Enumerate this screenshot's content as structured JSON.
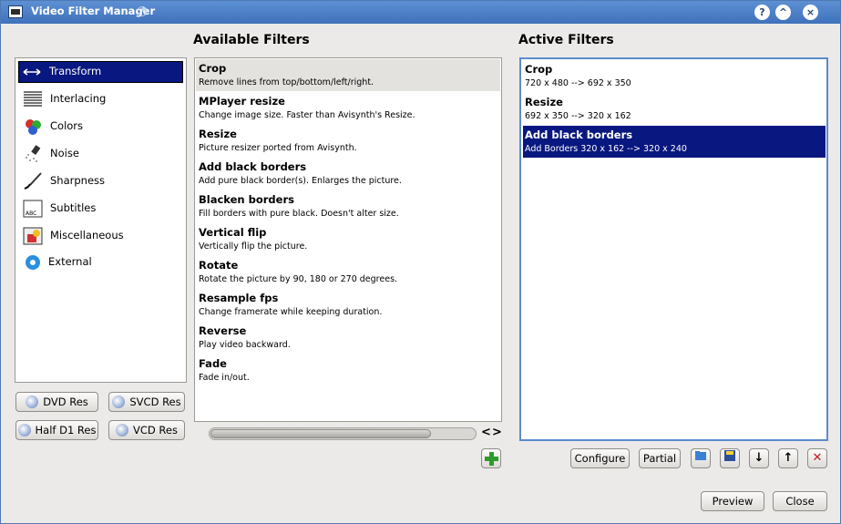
{
  "window": {
    "title": "Video Filter Manager",
    "help": "?",
    "shade": "^",
    "close": "×"
  },
  "sections": {
    "available": "Available Filters",
    "active": "Active Filters"
  },
  "categories": [
    {
      "label": "Transform",
      "icon": "transform-icon",
      "selected": true
    },
    {
      "label": "Interlacing",
      "icon": "interlacing-icon"
    },
    {
      "label": "Colors",
      "icon": "colors-icon"
    },
    {
      "label": "Noise",
      "icon": "noise-icon"
    },
    {
      "label": "Sharpness",
      "icon": "sharpness-icon"
    },
    {
      "label": "Subtitles",
      "icon": "subtitles-icon"
    },
    {
      "label": "Miscellaneous",
      "icon": "miscellaneous-icon"
    },
    {
      "label": "External",
      "icon": "external-icon"
    }
  ],
  "presets": {
    "dvd": "DVD Res",
    "svcd": "SVCD Res",
    "half_d1": "Half D1 Res",
    "vcd": "VCD Res"
  },
  "filters": [
    {
      "name": "Crop",
      "desc": "Remove lines from top/bottom/left/right."
    },
    {
      "name": "MPlayer resize",
      "desc": "Change image size. Faster than Avisynth's Resize."
    },
    {
      "name": "Resize",
      "desc": "Picture resizer ported from Avisynth."
    },
    {
      "name": "Add black borders",
      "desc": "Add pure black border(s). Enlarges the picture."
    },
    {
      "name": "Blacken borders",
      "desc": "Fill borders with pure black. Doesn't alter size."
    },
    {
      "name": "Vertical flip",
      "desc": "Vertically flip the picture."
    },
    {
      "name": "Rotate",
      "desc": "Rotate the picture by 90, 180 or 270 degrees."
    },
    {
      "name": "Resample fps",
      "desc": "Change framerate while keeping duration."
    },
    {
      "name": "Reverse",
      "desc": "Play video backward."
    },
    {
      "name": "Fade",
      "desc": "Fade in/out."
    }
  ],
  "scroll": {
    "left": "<",
    "right": ">"
  },
  "active_filters": [
    {
      "name": "Crop",
      "desc": "720 x 480 --> 692 x 350"
    },
    {
      "name": "Resize",
      "desc": "692 x 350 --> 320 x 162"
    },
    {
      "name": "Add black borders",
      "desc": "Add Borders 320 x 162 --> 320 x 240"
    }
  ],
  "actions": {
    "configure": "Configure",
    "partial": "Partial",
    "preview": "Preview",
    "close": "Close"
  },
  "icons": {
    "up": "↑",
    "down": "↓",
    "remove": "✕"
  }
}
